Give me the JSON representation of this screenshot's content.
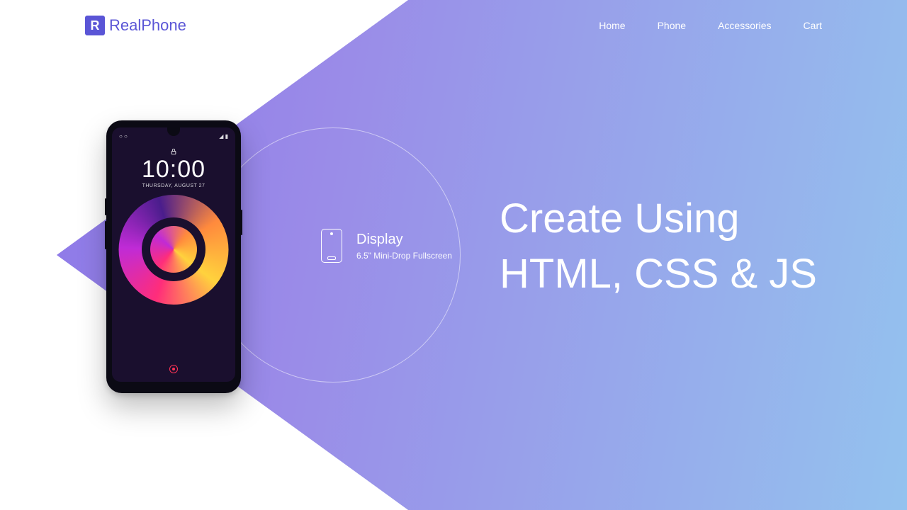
{
  "brand": {
    "logo_letter": "R",
    "name": "RealPhone"
  },
  "nav": {
    "items": [
      "Home",
      "Phone",
      "Accessories",
      "Cart"
    ]
  },
  "hero": {
    "line1": "Create Using",
    "line2": "HTML, CSS & JS"
  },
  "feature": {
    "title": "Display",
    "subtitle": "6.5\" Mini-Drop Fullscreen",
    "icon": "phone-display-icon"
  },
  "phone": {
    "clock_time": "10:00",
    "clock_date": "THURSDAY, AUGUST 27",
    "status_left": "○ ○",
    "status_right": "◢ ▮"
  },
  "colors": {
    "primary": "#5a55d6",
    "gradient_start": "#8b74e8",
    "gradient_end": "#94c2ee"
  }
}
